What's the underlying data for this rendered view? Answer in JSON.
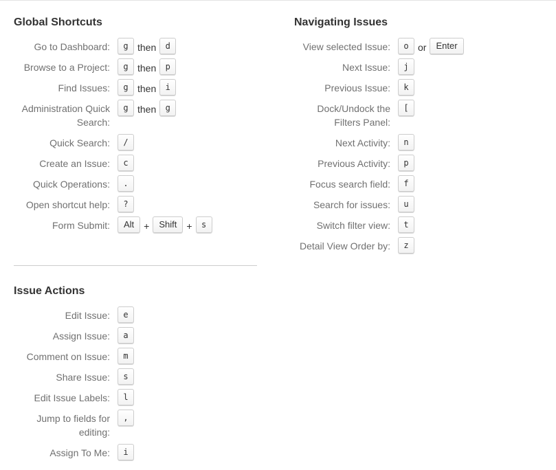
{
  "global": {
    "title": "Global Shortcuts",
    "rows": [
      {
        "label": "Go to Dashboard:",
        "k1": "g",
        "sep": "then",
        "k2": "d"
      },
      {
        "label": "Browse to a Project:",
        "k1": "g",
        "sep": "then",
        "k2": "p"
      },
      {
        "label": "Find Issues:",
        "k1": "g",
        "sep": "then",
        "k2": "i"
      },
      {
        "label": "Administration Quick Search:",
        "k1": "g",
        "sep": "then",
        "k2": "g"
      },
      {
        "label": "Quick Search:",
        "k1": "/"
      },
      {
        "label": "Create an Issue:",
        "k1": "c"
      },
      {
        "label": "Quick Operations:",
        "k1": "."
      },
      {
        "label": "Open shortcut help:",
        "k1": "?"
      },
      {
        "label": "Form Submit:",
        "k1": "Alt",
        "sep": "+",
        "k2": "Shift",
        "sep2": "+",
        "k3": "s"
      }
    ]
  },
  "navigating": {
    "title": "Navigating Issues",
    "rows": [
      {
        "label": "View selected Issue:",
        "k1": "o",
        "sep": "or",
        "k2": "Enter"
      },
      {
        "label": "Next Issue:",
        "k1": "j"
      },
      {
        "label": "Previous Issue:",
        "k1": "k"
      },
      {
        "label": "Dock/Undock the Filters Panel:",
        "k1": "["
      },
      {
        "label": "Next Activity:",
        "k1": "n"
      },
      {
        "label": "Previous Activity:",
        "k1": "p"
      },
      {
        "label": "Focus search field:",
        "k1": "f"
      },
      {
        "label": "Search for issues:",
        "k1": "u"
      },
      {
        "label": "Switch filter view:",
        "k1": "t"
      },
      {
        "label": "Detail View Order by:",
        "k1": "z"
      }
    ]
  },
  "actions": {
    "title": "Issue Actions",
    "rows": [
      {
        "label": "Edit Issue:",
        "k1": "e"
      },
      {
        "label": "Assign Issue:",
        "k1": "a"
      },
      {
        "label": "Comment on Issue:",
        "k1": "m"
      },
      {
        "label": "Share Issue:",
        "k1": "s"
      },
      {
        "label": "Edit Issue Labels:",
        "k1": "l"
      },
      {
        "label": "Jump to fields for editing:",
        "k1": ","
      },
      {
        "label": "Assign To Me:",
        "k1": "i"
      }
    ]
  }
}
